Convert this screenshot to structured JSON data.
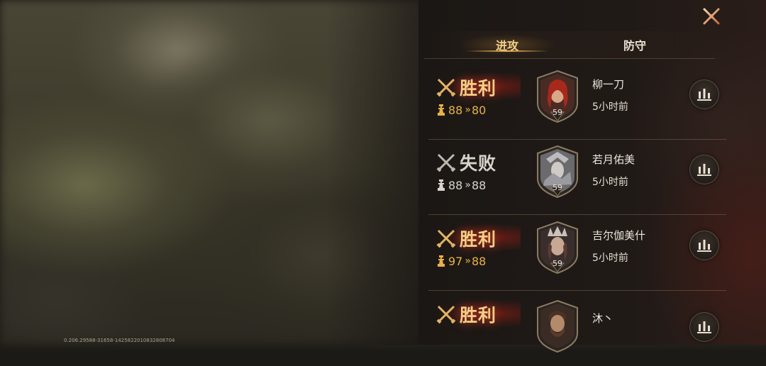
{
  "background": {
    "version_text": "0.206.29588-31658-1425822010832808704"
  },
  "header": {
    "tabs": [
      {
        "label": "进攻",
        "active": true
      },
      {
        "label": "防守",
        "active": false
      }
    ]
  },
  "colors": {
    "win_text": "#f3ce86",
    "score_gold": "#e8b04a",
    "lose_text": "#d8d3cc",
    "accent": "#e8b35a"
  },
  "battles": [
    {
      "result": "胜利",
      "outcome": "win",
      "score_from": "88",
      "score_to": "80",
      "level": "59",
      "name": "柳一刀",
      "time": "5小时前",
      "avatar_icon": "red-hair-hero-icon"
    },
    {
      "result": "失败",
      "outcome": "lose",
      "score_from": "88",
      "score_to": "88",
      "level": "59",
      "name": "若月佑美",
      "time": "5小时前",
      "avatar_icon": "armored-hero-icon"
    },
    {
      "result": "胜利",
      "outcome": "win",
      "score_from": "97",
      "score_to": "88",
      "level": "59",
      "name": "吉尔伽美什",
      "time": "5小时前",
      "avatar_icon": "crowned-hero-icon"
    },
    {
      "result": "胜利",
      "outcome": "win",
      "score_from": "",
      "score_to": "",
      "level": "",
      "name": "沐丶",
      "time": "",
      "avatar_icon": "bearded-hero-icon"
    }
  ]
}
